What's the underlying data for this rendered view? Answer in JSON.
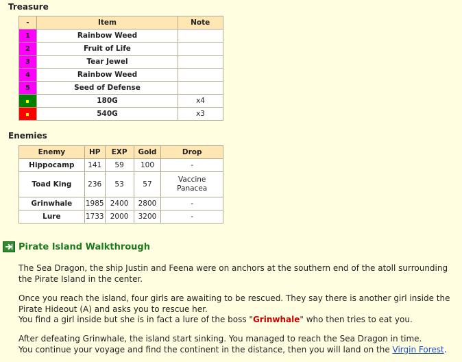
{
  "treasure": {
    "heading": "Treasure",
    "headers": [
      "-",
      "Item",
      "Note"
    ],
    "rows": [
      {
        "marker": "1",
        "marker_color": "#ff00ff",
        "item": "Rainbow Weed",
        "note": ""
      },
      {
        "marker": "2",
        "marker_color": "#ff00ff",
        "item": "Fruit of Life",
        "note": ""
      },
      {
        "marker": "3",
        "marker_color": "#ff00ff",
        "item": "Tear Jewel",
        "note": ""
      },
      {
        "marker": "4",
        "marker_color": "#ff00ff",
        "item": "Rainbow Weed",
        "note": ""
      },
      {
        "marker": "5",
        "marker_color": "#ff00ff",
        "item": "Seed of Defense",
        "note": ""
      },
      {
        "marker": "dot",
        "marker_color": "#008000",
        "item": "180G",
        "note": "x4"
      },
      {
        "marker": "dot",
        "marker_color": "#ff0000",
        "item": "540G",
        "note": "x3"
      }
    ]
  },
  "enemies": {
    "heading": "Enemies",
    "headers": [
      "Enemy",
      "HP",
      "EXP",
      "Gold",
      "Drop"
    ],
    "rows": [
      {
        "name": "Hippocamp",
        "hp": "141",
        "exp": "59",
        "gold": "100",
        "drop1": "-",
        "drop2": "",
        "boss": false
      },
      {
        "name": "Toad King",
        "hp": "236",
        "exp": "53",
        "gold": "57",
        "drop1": "Vaccine",
        "drop2": "Panacea",
        "boss": false
      },
      {
        "name": "Grinwhale",
        "hp": "1985",
        "exp": "2400",
        "gold": "2800",
        "drop1": "-",
        "drop2": "",
        "boss": true
      },
      {
        "name": "Lure",
        "hp": "1733",
        "exp": "2000",
        "gold": "3200",
        "drop1": "-",
        "drop2": "",
        "boss": true
      }
    ]
  },
  "walkthrough": {
    "title": "Pirate Island Walkthrough",
    "p1": "The Sea Dragon, the ship Justin and Feena were on anchors at the southern end of the atoll surrounding the Pirate Island in the center.",
    "p2a": "Once you reach the island, four girls are awaiting to be rescued. They say there is another girl inside the Pirate Hideout (A) and asks you to rescue her.",
    "p2b_before": "You find a girl inside but she is in fact a lure of the boss \"",
    "p2b_boss": "Grinwhale",
    "p2b_after": "\" who then tries to eat you.",
    "p3a": "After defeating Grinwhale, the island start sinking. You managed to reach the Sea Dragon in time.",
    "p3b_before": "You continue your voyage and find the continent in the distance, then you will land on the ",
    "p3b_link": "Virgin Forest",
    "p3b_after": "."
  }
}
